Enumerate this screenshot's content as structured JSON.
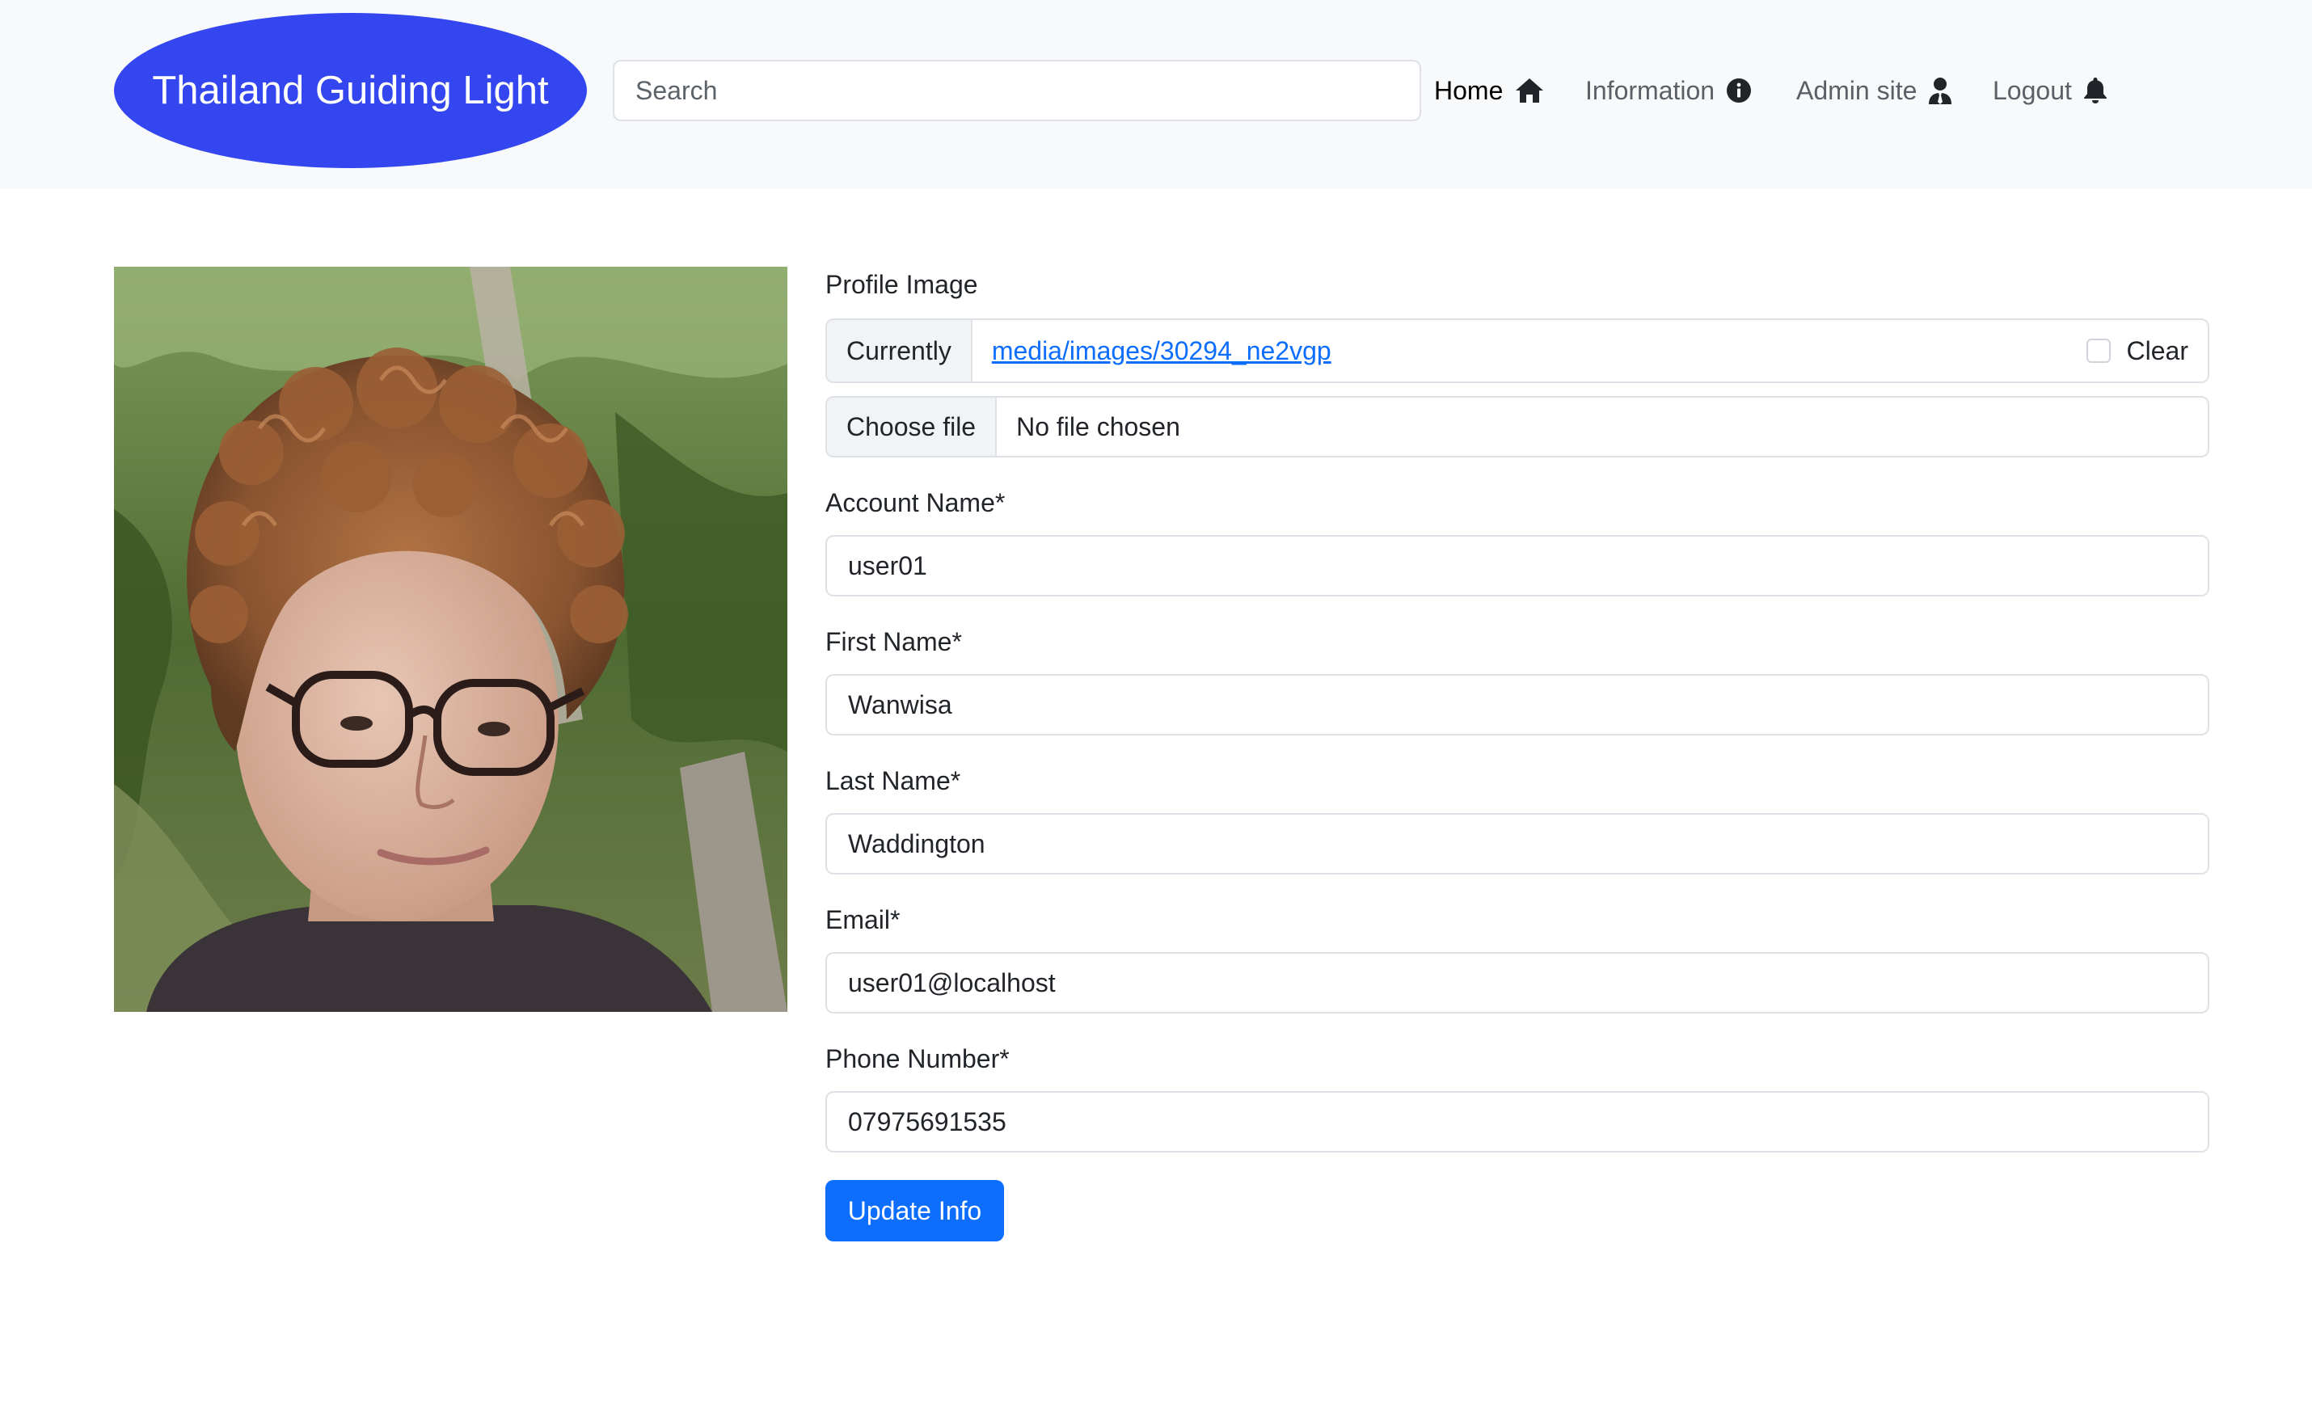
{
  "navbar": {
    "brand": "Thailand Guiding Light",
    "search_placeholder": "Search",
    "items": [
      {
        "label": "Home",
        "icon": "home-icon",
        "active": true
      },
      {
        "label": "Information",
        "icon": "info-icon",
        "active": false
      },
      {
        "label": "Admin site",
        "icon": "user-tie-icon",
        "active": false
      },
      {
        "label": "Logout",
        "icon": "bell-icon",
        "active": false
      }
    ]
  },
  "profile": {
    "image_label": "Profile Image",
    "currently_label": "Currently",
    "current_file": "media/images/30294_ne2vgp",
    "clear_label": "Clear",
    "choose_file_label": "Choose file",
    "no_file_text": "No file chosen"
  },
  "form": {
    "account_name": {
      "label": "Account Name*",
      "value": "user01"
    },
    "first_name": {
      "label": "First Name*",
      "value": "Wanwisa"
    },
    "last_name": {
      "label": "Last Name*",
      "value": "Waddington"
    },
    "email": {
      "label": "Email*",
      "value": "user01@localhost"
    },
    "phone": {
      "label": "Phone Number*",
      "value": "07975691535"
    },
    "submit_label": "Update Info"
  },
  "colors": {
    "brand_bg": "#3446f0",
    "primary": "#0d6efd",
    "navbar_bg": "#f8f9fa"
  }
}
